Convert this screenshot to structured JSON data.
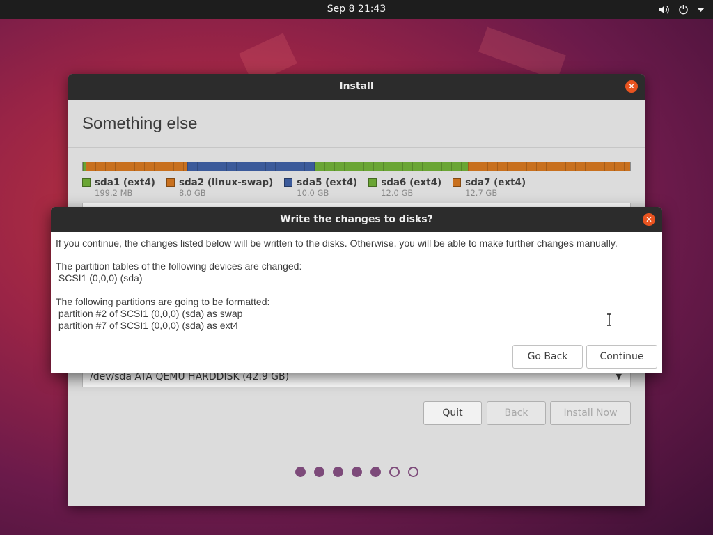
{
  "topbar": {
    "clock": "Sep 8  21:43",
    "icons": [
      "volume-icon",
      "power-icon",
      "chevron-down-icon"
    ]
  },
  "installer": {
    "title": "Install",
    "heading": "Something else",
    "partitions": [
      {
        "name": "sda1 (ext4)",
        "size": "199.2 MB",
        "color": "#6aa534"
      },
      {
        "name": "sda2 (linux-swap)",
        "size": "8.0 GB",
        "color": "#c8701e"
      },
      {
        "name": "sda5 (ext4)",
        "size": "10.0 GB",
        "color": "#3b5a9a"
      },
      {
        "name": "sda6 (ext4)",
        "size": "12.0 GB",
        "color": "#6aa534"
      },
      {
        "name": "sda7 (ext4)",
        "size": "12.7 GB",
        "color": "#c8701e"
      }
    ],
    "device_select": "/dev/sda   ATA QEMU HARDDISK (42.9 GB)",
    "buttons": {
      "quit": "Quit",
      "back": "Back",
      "install_now": "Install Now"
    },
    "progress": {
      "total_steps": 7,
      "completed_steps": 5
    }
  },
  "dialog": {
    "title": "Write the changes to disks?",
    "intro": "If you continue, the changes listed below will be written to the disks. Otherwise, you will be able to make further changes manually.",
    "tables_heading": "The partition tables of the following devices are changed:",
    "tables_device": " SCSI1 (0,0,0) (sda)",
    "format_heading": "The following partitions are going to be formatted:",
    "format_items": [
      " partition #2 of SCSI1 (0,0,0) (sda) as swap",
      " partition #7 of SCSI1 (0,0,0) (sda) as ext4"
    ],
    "buttons": {
      "go_back": "Go Back",
      "continue": "Continue"
    }
  },
  "colors": {
    "accent": "#e95420",
    "progress_dot": "#7d4a7a"
  }
}
